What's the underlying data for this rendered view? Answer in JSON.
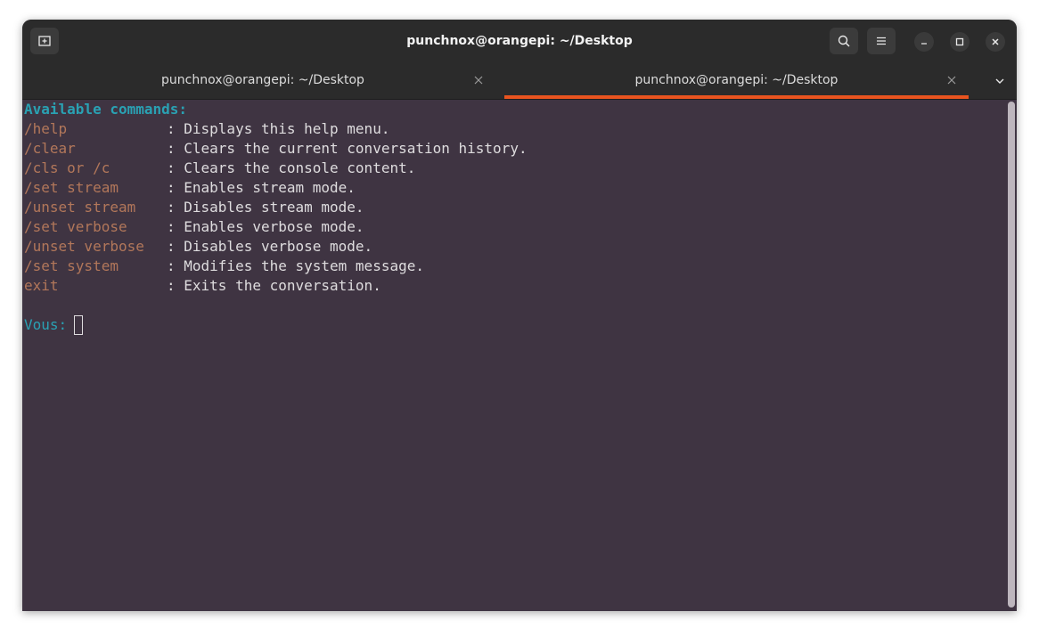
{
  "window": {
    "title": "punchnox@orangepi: ~/Desktop"
  },
  "toolbar": {
    "new_tab_icon": "new-tab-icon",
    "search_icon": "search-icon",
    "menu_icon": "hamburger-menu-icon",
    "minimize_icon": "minimize-icon",
    "maximize_icon": "maximize-icon",
    "close_icon": "close-icon"
  },
  "tabs": [
    {
      "label": "punchnox@orangepi: ~/Desktop",
      "active": false
    },
    {
      "label": "punchnox@orangepi: ~/Desktop",
      "active": true
    }
  ],
  "terminal": {
    "heading": "Available commands:",
    "commands": [
      {
        "cmd": "/help",
        "desc": ": Displays this help menu."
      },
      {
        "cmd": "/clear",
        "desc": ": Clears the current conversation history."
      },
      {
        "cmd": "/cls or /c",
        "desc": ": Clears the console content."
      },
      {
        "cmd": "/set stream",
        "desc": ": Enables stream mode."
      },
      {
        "cmd": "/unset stream",
        "desc": ": Disables stream mode."
      },
      {
        "cmd": "/set verbose",
        "desc": ": Enables verbose mode."
      },
      {
        "cmd": "/unset verbose",
        "desc": ": Disables verbose mode."
      },
      {
        "cmd": "/set system",
        "desc": ": Modifies the system message."
      },
      {
        "cmd": "exit",
        "desc": ": Exits the conversation."
      }
    ],
    "prompt": "Vous:"
  },
  "colors": {
    "background": "#3f3442",
    "heading": "#2aa1b3",
    "command": "#b2775a",
    "text": "#dedcde",
    "tab_accent": "#e9541f"
  }
}
